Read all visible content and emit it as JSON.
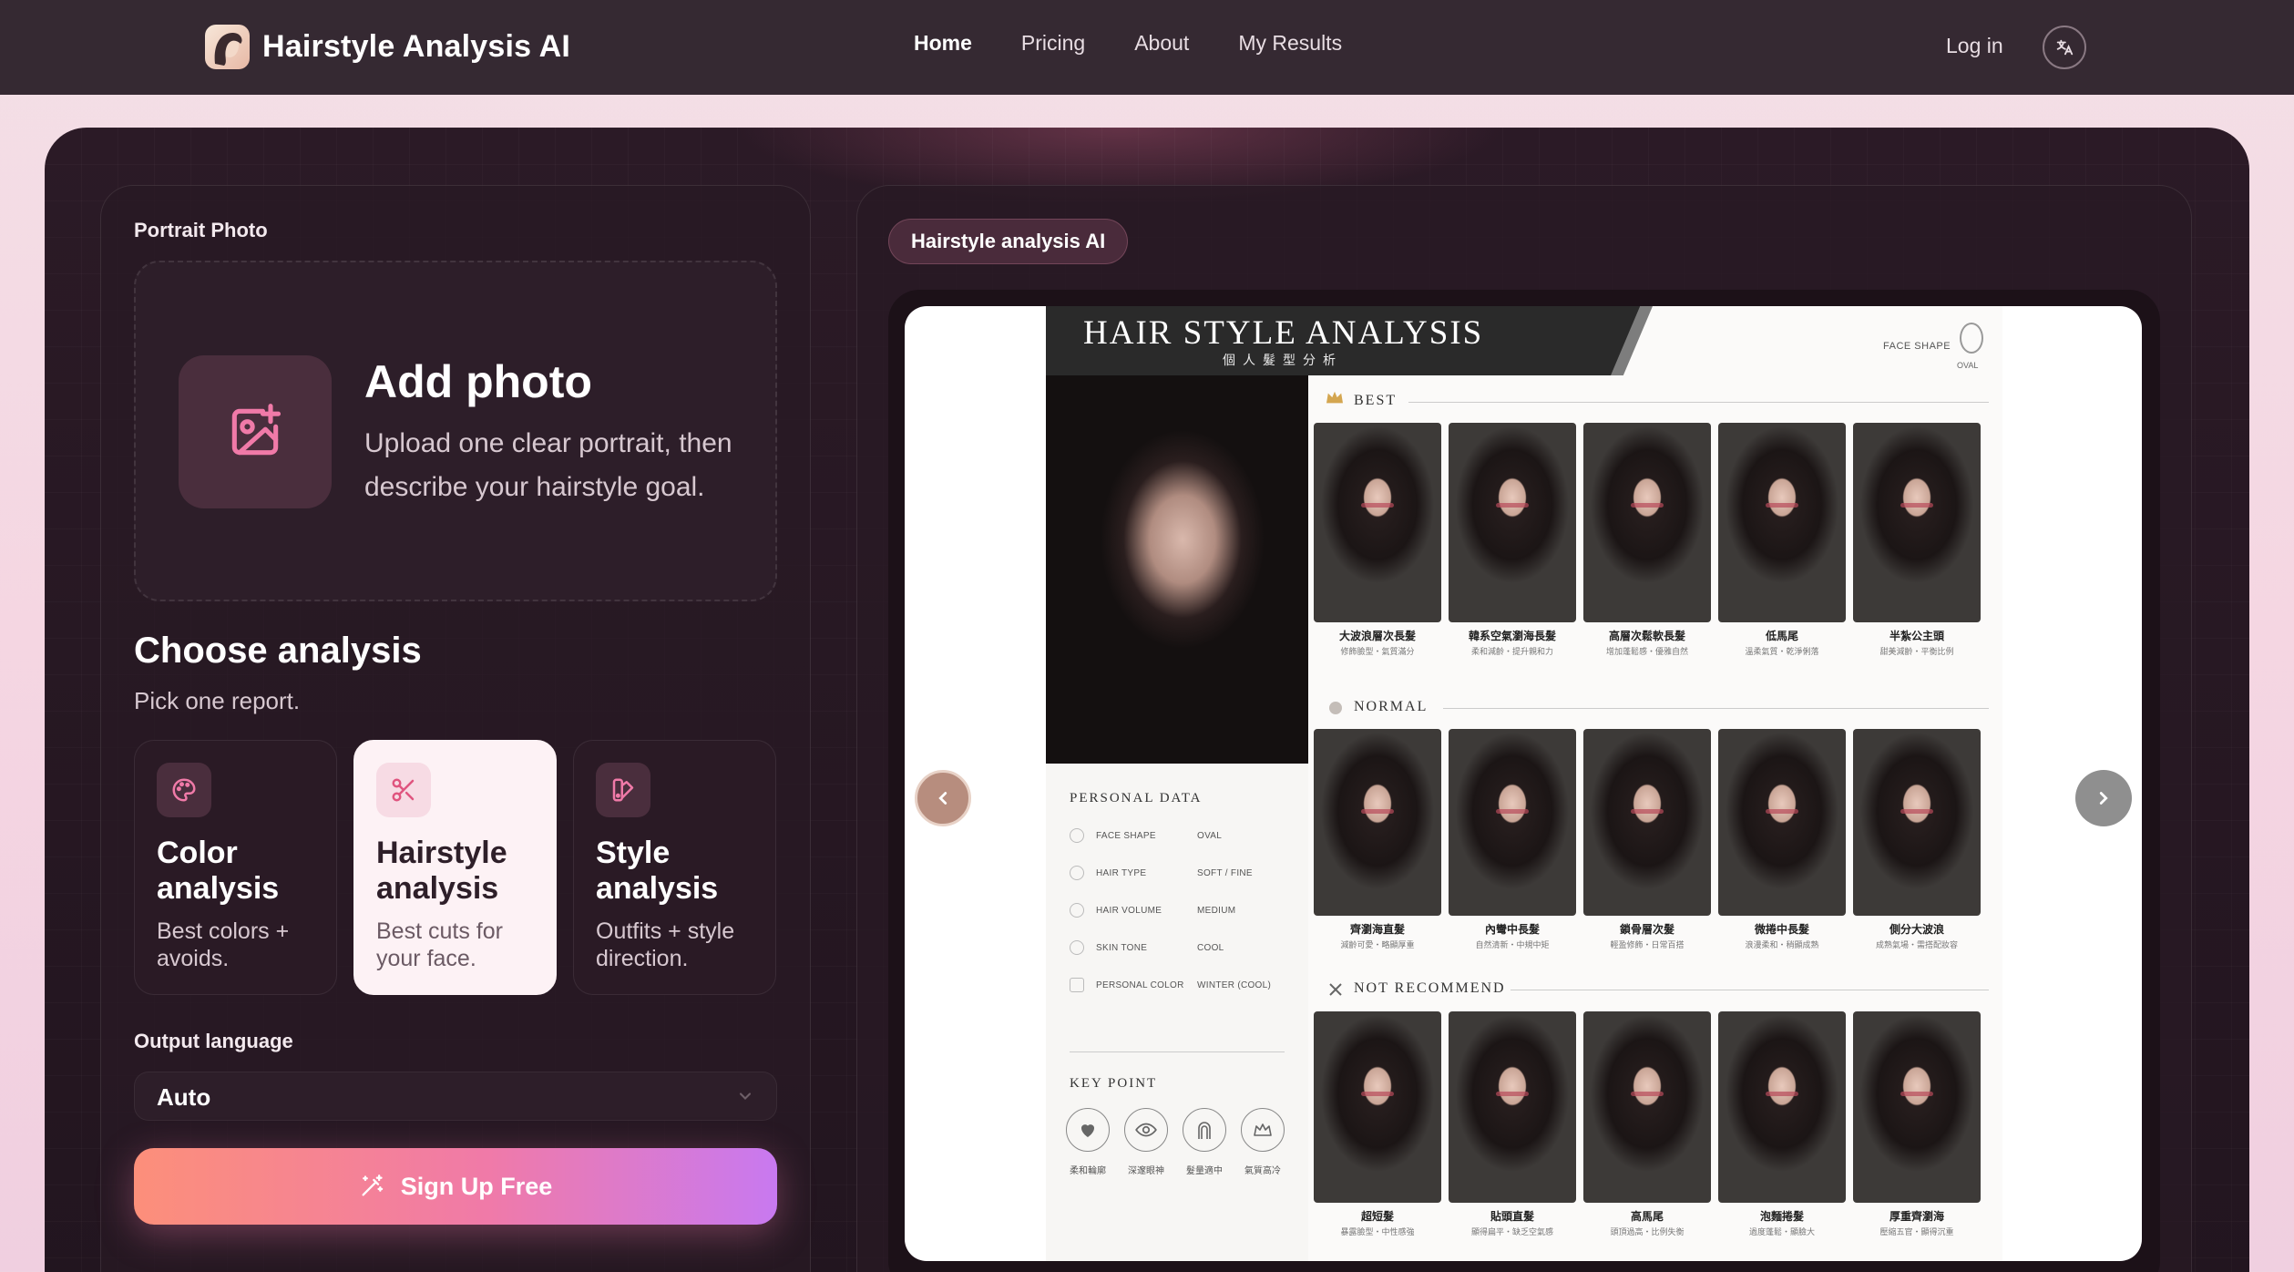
{
  "nav": {
    "brand": "Hairstyle Analysis AI",
    "links": [
      "Home",
      "Pricing",
      "About",
      "My Results"
    ],
    "active": "Home",
    "login": "Log in",
    "language_icon": "translate-icon"
  },
  "left": {
    "portrait_label": "Portrait Photo",
    "upload": {
      "title": "Add photo",
      "description": "Upload one clear portrait, then describe your hairstyle goal.",
      "icon": "image-plus-icon"
    },
    "choose_title": "Choose analysis",
    "choose_subtitle": "Pick one report.",
    "options": [
      {
        "title": "Color analysis",
        "desc": "Best colors + avoids.",
        "icon": "palette-icon",
        "selected": false
      },
      {
        "title": "Hairstyle analysis",
        "desc": "Best cuts for your face.",
        "icon": "scissors-icon",
        "selected": true
      },
      {
        "title": "Style analysis",
        "desc": "Outfits + style direction.",
        "icon": "swatch-icon",
        "selected": false
      }
    ],
    "output_language_label": "Output language",
    "output_language_value": "Auto",
    "signup_label": "Sign Up Free"
  },
  "right": {
    "pill": "Hairstyle analysis AI",
    "report": {
      "title": "HAIR STYLE ANALYSIS",
      "subtitle": "個人髮型分析",
      "face_shape_label": "FACE SHAPE",
      "face_shape_value": "OVAL",
      "personal_data_title": "PERSONAL DATA",
      "personal_data": [
        {
          "k": "FACE SHAPE",
          "v": "OVAL"
        },
        {
          "k": "HAIR TYPE",
          "v": "SOFT / FINE"
        },
        {
          "k": "HAIR VOLUME",
          "v": "MEDIUM"
        },
        {
          "k": "SKIN TONE",
          "v": "COOL"
        },
        {
          "k": "PERSONAL COLOR",
          "v": "WINTER (COOL)"
        }
      ],
      "key_point_title": "KEY POINT",
      "key_points": [
        {
          "label": "柔和輪廓",
          "icon": "heart-icon"
        },
        {
          "label": "深邃眼神",
          "icon": "eye-icon"
        },
        {
          "label": "髮量適中",
          "icon": "hair-icon"
        },
        {
          "label": "氣質高冷",
          "icon": "crown-icon"
        }
      ],
      "sections": [
        {
          "title": "BEST",
          "icon": "crown-icon",
          "items": [
            {
              "name": "大波浪層次長髮",
              "desc": "修飾臉型・氣質滿分"
            },
            {
              "name": "韓系空氣瀏海長髮",
              "desc": "柔和減齡・提升親和力"
            },
            {
              "name": "高層次鬆軟長髮",
              "desc": "增加蓬鬆感・優雅自然"
            },
            {
              "name": "低馬尾",
              "desc": "溫柔氣質・乾淨俐落"
            },
            {
              "name": "半紮公主頭",
              "desc": "甜美減齡・平衡比例"
            }
          ]
        },
        {
          "title": "NORMAL",
          "icon": "dot-icon",
          "items": [
            {
              "name": "齊瀏海直髮",
              "desc": "減齡可愛・略顯厚重"
            },
            {
              "name": "內彎中長髮",
              "desc": "自然清新・中規中矩"
            },
            {
              "name": "鎖骨層次髮",
              "desc": "輕盈修飾・日常百搭"
            },
            {
              "name": "微捲中長髮",
              "desc": "浪漫柔和・稍顯成熟"
            },
            {
              "name": "側分大波浪",
              "desc": "成熟氣場・需搭配妝容"
            }
          ]
        },
        {
          "title": "NOT RECOMMEND",
          "icon": "x-icon",
          "items": [
            {
              "name": "超短髮",
              "desc": "暴露臉型・中性感強"
            },
            {
              "name": "貼頭直髮",
              "desc": "顯得扁平・缺乏空氣感"
            },
            {
              "name": "高馬尾",
              "desc": "頭頂過高・比例失衡"
            },
            {
              "name": "泡麵捲髮",
              "desc": "過度蓬鬆・顯臉大"
            },
            {
              "name": "厚重齊瀏海",
              "desc": "壓縮五官・顯得沉重"
            }
          ]
        }
      ]
    }
  }
}
